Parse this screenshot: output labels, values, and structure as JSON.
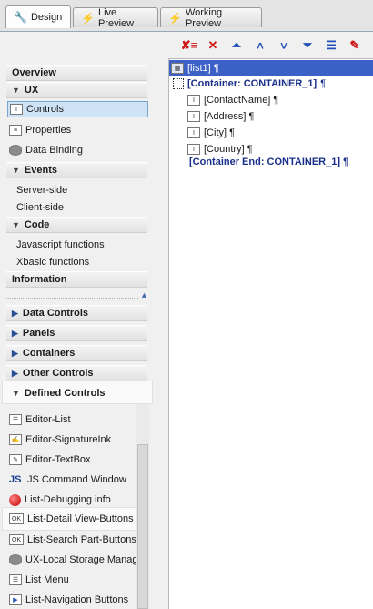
{
  "tabs": [
    {
      "label": "Design",
      "icon": "wrench-icon",
      "active": true
    },
    {
      "label": "Live Preview",
      "icon": "lightning-icon",
      "active": false
    },
    {
      "label": "Working Preview",
      "icon": "lightning-icon",
      "active": false
    }
  ],
  "toolbar": {
    "icons": [
      "delete-all-icon",
      "delete-icon",
      "move-top-icon",
      "move-up-icon",
      "move-down-icon",
      "move-bottom-icon",
      "properties-icon",
      "edit-icon"
    ]
  },
  "sidebar": {
    "overview": "Overview",
    "ux": "UX",
    "ux_items": [
      "Controls",
      "Properties",
      "Data Binding"
    ],
    "events": "Events",
    "events_items": [
      "Server-side",
      "Client-side"
    ],
    "code": "Code",
    "code_items": [
      "Javascript functions",
      "Xbasic functions"
    ],
    "information": "Information",
    "groups": [
      "Data Controls",
      "Panels",
      "Containers",
      "Other Controls"
    ],
    "defined_controls": "Defined Controls",
    "defined_items": [
      {
        "label": "Editor-List",
        "icon": "list-editor-icon"
      },
      {
        "label": "Editor-SignatureInk",
        "icon": "signature-icon"
      },
      {
        "label": "Editor-TextBox",
        "icon": "textbox-icon"
      },
      {
        "label": "JS Command Window",
        "icon": "js-icon"
      },
      {
        "label": "List-Debugging info",
        "icon": "red-ball-icon"
      },
      {
        "label": "List-Detail View-Buttons",
        "icon": "ok-button-icon"
      },
      {
        "label": "List-Search Part-Buttons",
        "icon": "ok-button-icon"
      },
      {
        "label": "UX-Local Storage Manage",
        "icon": "database-icon"
      },
      {
        "label": "List Menu",
        "icon": "menu-icon"
      },
      {
        "label": "List-Navigation Buttons",
        "icon": "nav-icon"
      }
    ]
  },
  "tree": {
    "root": "[list1] ¶",
    "container": "[Container: CONTAINER_1]",
    "pilcrow": "¶",
    "fields": [
      "[ContactName] ¶",
      "[Address] ¶",
      "[City] ¶",
      "[Country] ¶"
    ],
    "container_end": "[Container End: CONTAINER_1] ¶"
  }
}
